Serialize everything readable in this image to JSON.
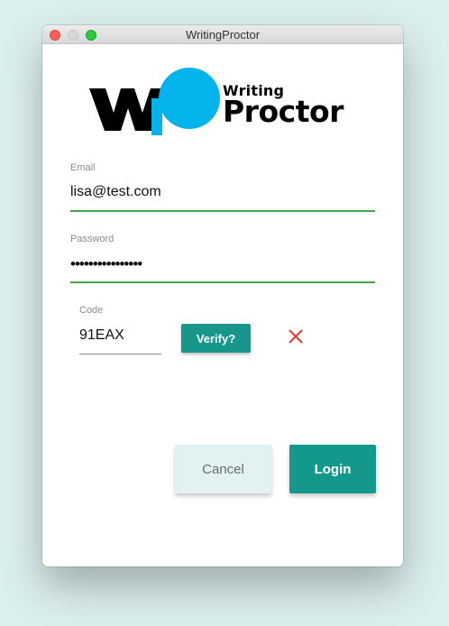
{
  "window": {
    "title": "WritingProctor"
  },
  "logo": {
    "mark_text": "WP",
    "line1": "Writing",
    "line2": "Proctor",
    "brand_color": "#02b3ec"
  },
  "form": {
    "email": {
      "label": "Email",
      "value": "lisa@test.com"
    },
    "password": {
      "label": "Password",
      "masked_value": "••••••••••••••••"
    },
    "code": {
      "label": "Code",
      "value": "91EAX",
      "verify_label": "Verify?",
      "error_icon": "close-icon"
    }
  },
  "actions": {
    "cancel_label": "Cancel",
    "login_label": "Login"
  },
  "colors": {
    "accent": "#14988c",
    "success_line": "#43a647",
    "error": "#e53935",
    "desktop": "#dcefef"
  }
}
